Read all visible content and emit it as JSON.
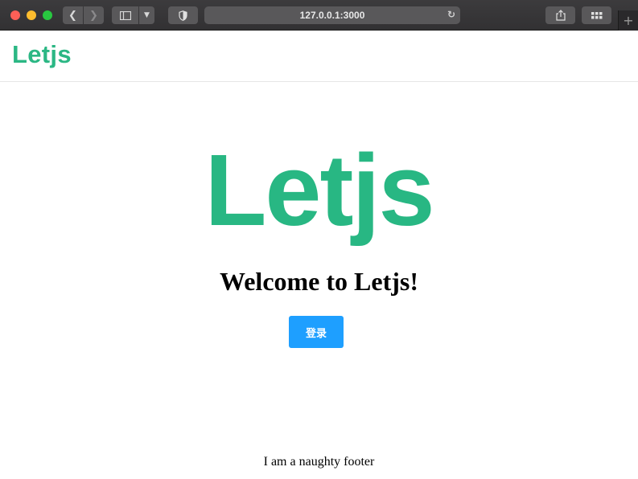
{
  "browser": {
    "url": "127.0.0.1:3000",
    "icons": {
      "back": "chevron-left-icon",
      "forward": "chevron-right-icon",
      "sidebar": "sidebar-icon",
      "shield": "shield-icon",
      "reload": "reload-icon",
      "share": "share-icon",
      "tabs": "tab-overview-icon",
      "new_tab": "plus-icon"
    }
  },
  "navbar": {
    "brand": "Letjs"
  },
  "hero": {
    "logo_text": "Letjs",
    "welcome": "Welcome to Letjs!",
    "login_label": "登录"
  },
  "footer": {
    "text": "I am a naughty footer"
  },
  "colors": {
    "brand_green": "#2bb784",
    "button_blue": "#1e9fff"
  }
}
